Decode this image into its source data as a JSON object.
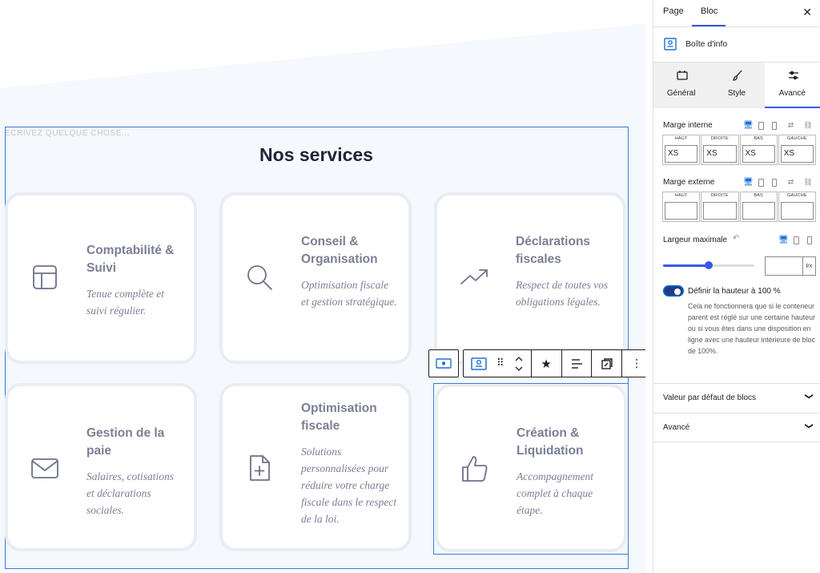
{
  "canvas": {
    "placeholder": "ÉCRIVEZ QUELQUE CHOSE...",
    "section_title": "Nos services",
    "cards": [
      {
        "title": "Comptabilité & Suivi",
        "desc": "Tenue complète et suivi régulier.",
        "icon": "layout-icon"
      },
      {
        "title": "Conseil & Organisation",
        "desc": "Optimisation fiscale et gestion stratégique.",
        "icon": "search-icon"
      },
      {
        "title": "Déclarations fiscales",
        "desc": "Respect de toutes vos obligations légales.",
        "icon": "trending-up-icon"
      },
      {
        "title": "Gestion de la paie",
        "desc": "Salaires, cotisations et déclarations sociales.",
        "icon": "mail-icon"
      },
      {
        "title": "Optimisation fiscale",
        "desc": "Solutions personnalisées pour réduire votre charge fiscale dans le respect de la loi.",
        "icon": "file-plus-icon"
      },
      {
        "title": "Création & Liquidation",
        "desc": "Accompagnement complet à chaque étape.",
        "icon": "thumbs-up-icon"
      }
    ]
  },
  "sidebar": {
    "tabs": {
      "page": "Page",
      "bloc": "Bloc"
    },
    "block_name": "Boîte d'info",
    "subtabs": {
      "general": "Général",
      "style": "Style",
      "advanced": "Avancé"
    },
    "padding": {
      "label": "Marge interne",
      "heads": [
        "HAUT",
        "DROITE",
        "BAS",
        "GAUCHE"
      ],
      "values": [
        "XS",
        "XS",
        "XS",
        "XS"
      ]
    },
    "margin": {
      "label": "Marge externe",
      "heads": [
        "HAUT",
        "DROITE",
        "BAS",
        "GAUCHE"
      ],
      "values": [
        "",
        "",
        "",
        ""
      ]
    },
    "max_width": {
      "label": "Largeur maximale",
      "unit": "PX",
      "slider_value": 0.5
    },
    "full_height": {
      "label": "Définir la hauteur à 100 %",
      "enabled": true,
      "help": "Cela ne fonctionnera que si le conteneur parent est réglé sur une certaine hauteur ou si vous êtes dans une disposition en ligne avec une hauteur intérieure de bloc de 100%."
    },
    "panels": [
      "Valeur par défaut de blocs",
      "Avancé"
    ]
  },
  "colors": {
    "accent": "#3858e9",
    "selection": "#3a7bd5",
    "card_text": "#7b7f95",
    "title": "#1f2437"
  }
}
